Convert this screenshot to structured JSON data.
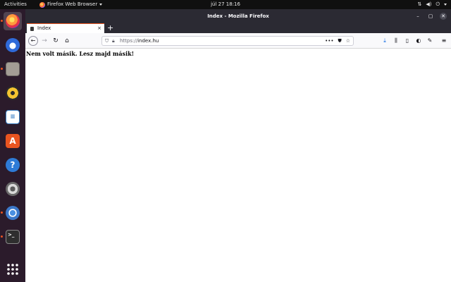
{
  "topbar": {
    "activities": "Activities",
    "app_name": "Firefox Web Browser",
    "clock": "júl 27  18:16"
  },
  "dock": {
    "items": [
      {
        "name": "firefox",
        "icon": "firefox-icon"
      },
      {
        "name": "thunderbird",
        "icon": "mail-icon"
      },
      {
        "name": "files",
        "icon": "folder-icon"
      },
      {
        "name": "rhythmbox",
        "icon": "music-icon"
      },
      {
        "name": "libreoffice-writer",
        "icon": "writer-icon"
      },
      {
        "name": "software",
        "icon": "software-center-icon"
      },
      {
        "name": "help",
        "icon": "help-icon"
      },
      {
        "name": "settings",
        "icon": "settings-icon"
      },
      {
        "name": "chromium",
        "icon": "chromium-icon"
      },
      {
        "name": "terminal",
        "icon": "terminal-icon"
      },
      {
        "name": "show-apps",
        "icon": "grid-icon"
      }
    ]
  },
  "window": {
    "title": "Index - Mozilla Firefox"
  },
  "tab": {
    "title": "Index",
    "close": "×",
    "new_tab": "+"
  },
  "nav": {
    "url_scheme": "https://",
    "url_host": "index.hu"
  },
  "page": {
    "text": "Nem volt másik. Lesz majd másik!"
  },
  "colors": {
    "accent": "#e95420",
    "dock_bg": "#2b1b2b",
    "titlebar_bg": "#2b2a33"
  }
}
